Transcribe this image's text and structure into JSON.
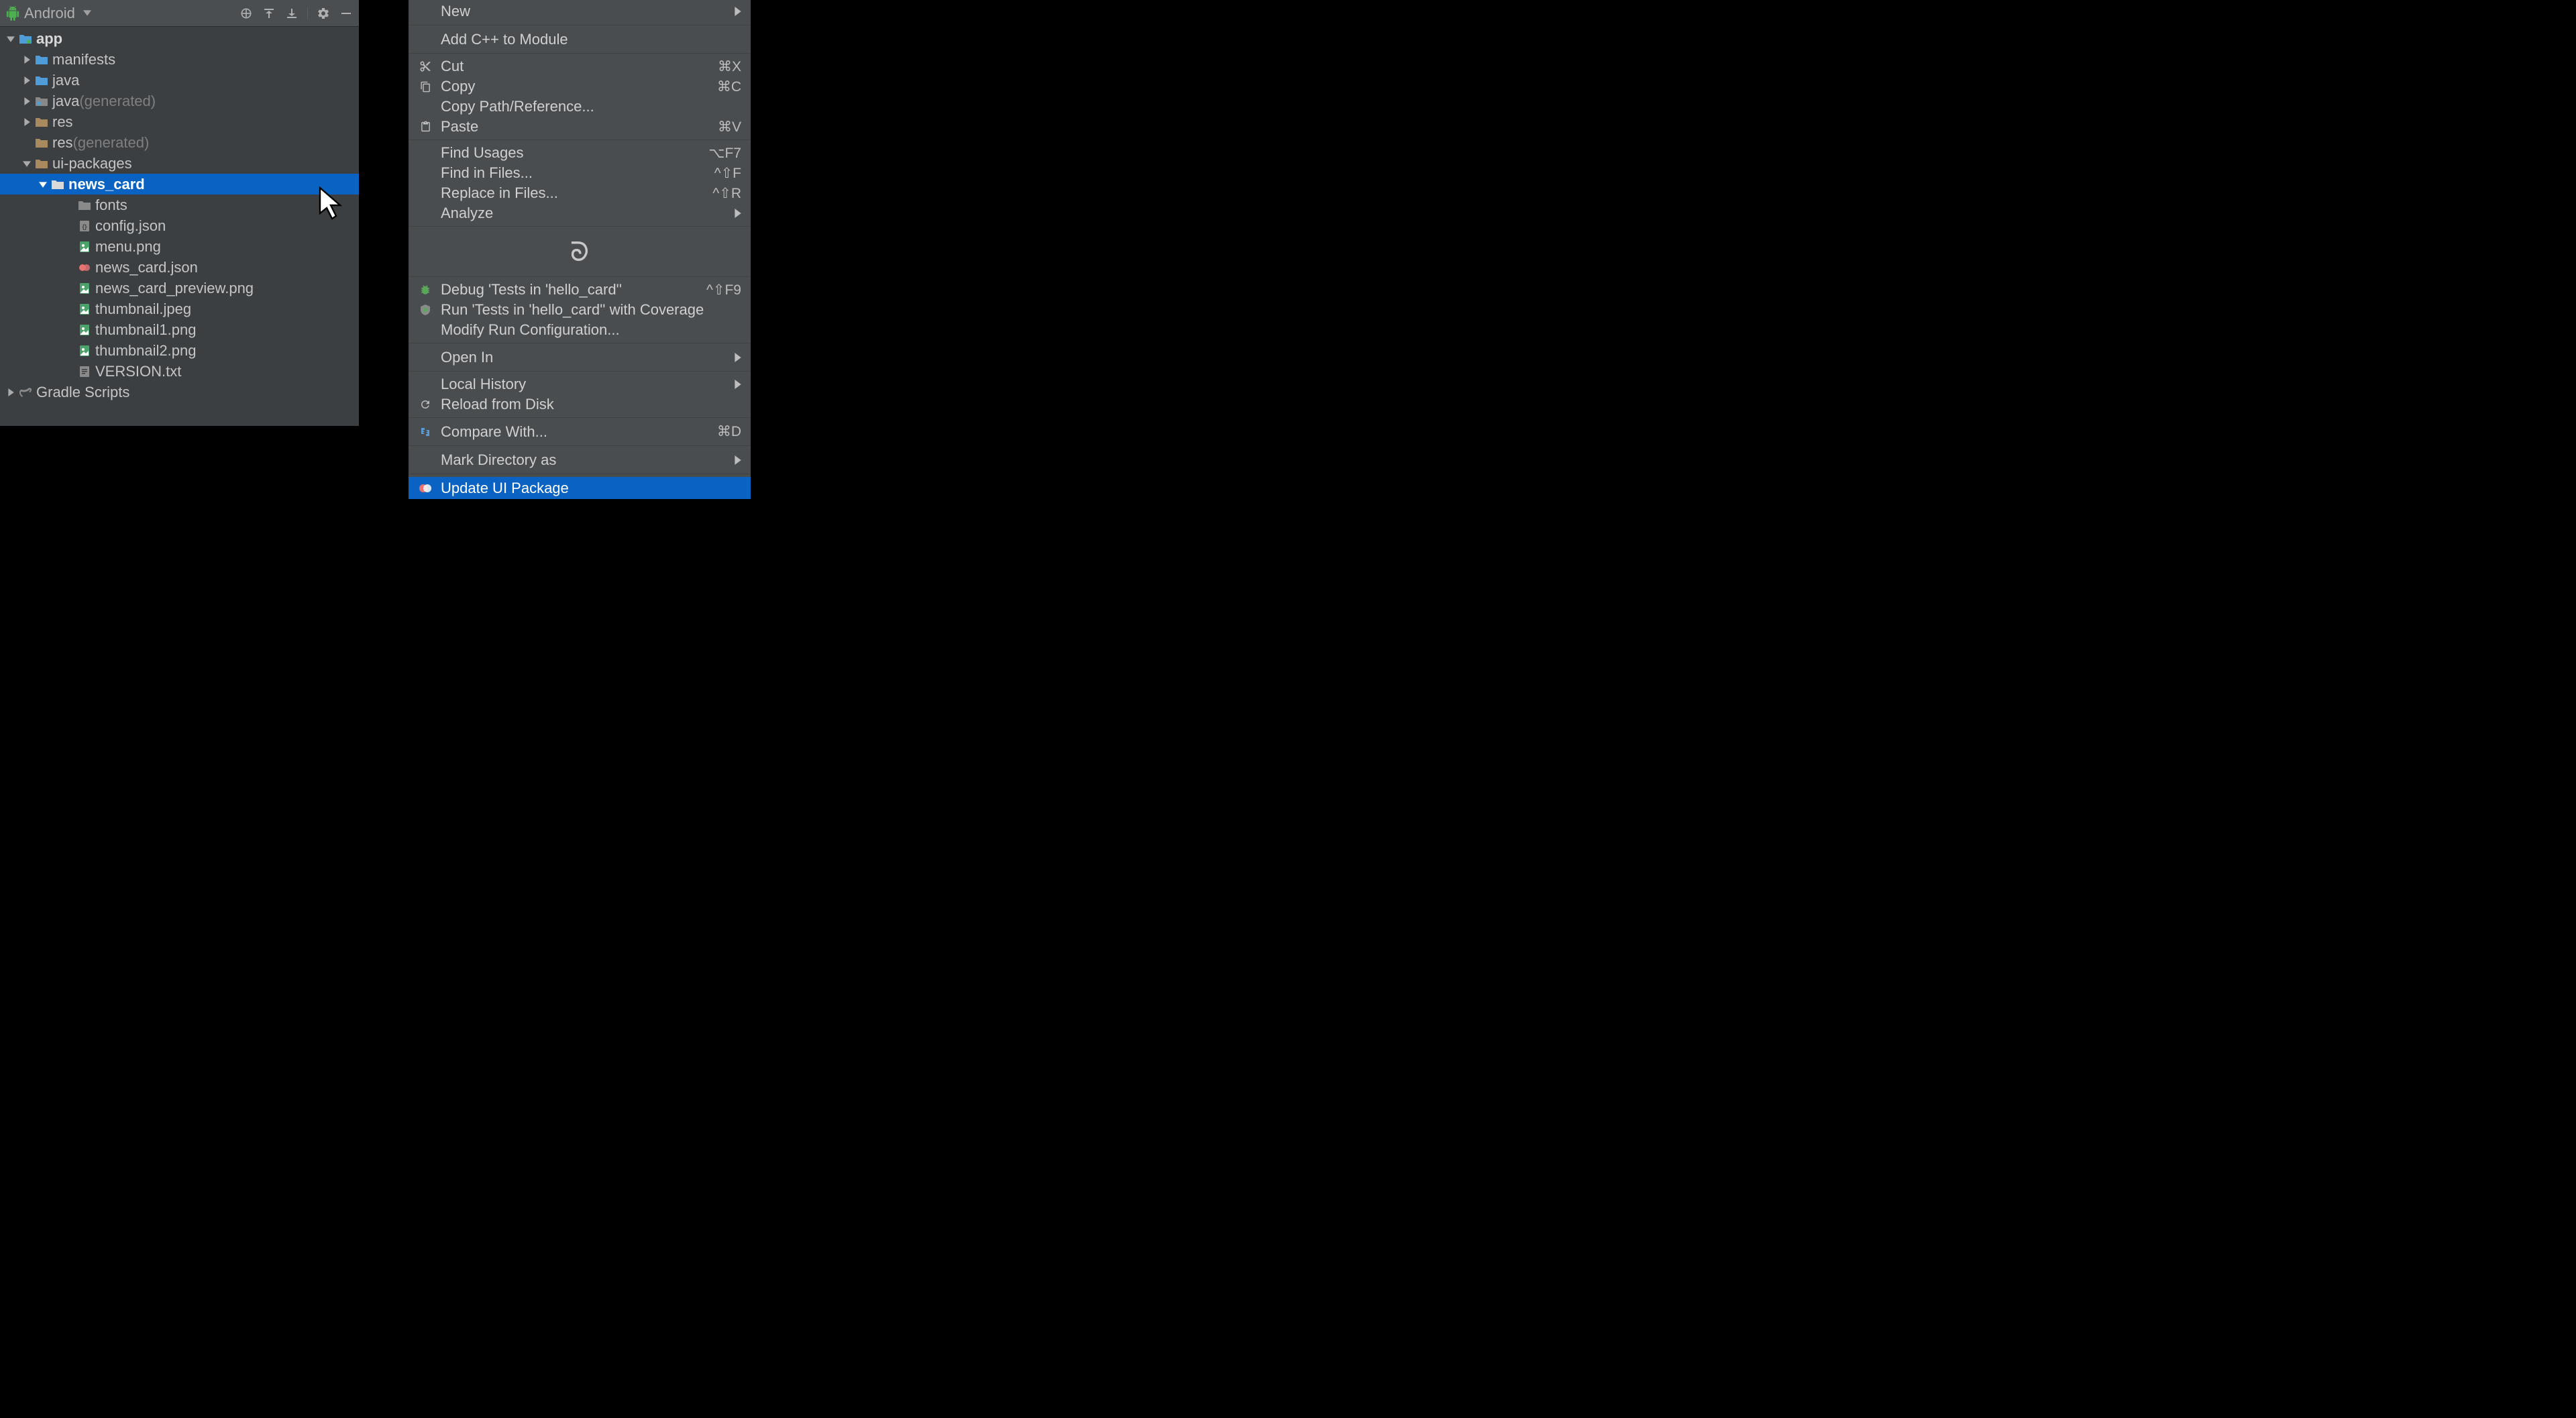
{
  "panel": {
    "view_label": "Android",
    "tree": {
      "app": "app",
      "manifests": "manifests",
      "java": "java",
      "java_gen": "java",
      "java_gen_suffix": " (generated)",
      "res": "res",
      "res_gen": "res",
      "res_gen_suffix": " (generated)",
      "ui_packages": "ui-packages",
      "news_card": "news_card",
      "fonts": "fonts",
      "config_json": "config.json",
      "menu_png": "menu.png",
      "news_card_json": "news_card.json",
      "news_card_preview_png": "news_card_preview.png",
      "thumbnail_jpeg": "thumbnail.jpeg",
      "thumbnail1_png": "thumbnail1.png",
      "thumbnail2_png": "thumbnail2.png",
      "version_txt": "VERSION.txt",
      "gradle_scripts": "Gradle Scripts"
    }
  },
  "menu": {
    "new": "New",
    "add_cpp": "Add C++ to Module",
    "cut": "Cut",
    "cut_sc": "⌘X",
    "copy": "Copy",
    "copy_sc": "⌘C",
    "copy_path": "Copy Path/Reference...",
    "paste": "Paste",
    "paste_sc": "⌘V",
    "find_usages": "Find Usages",
    "find_usages_sc": "⌥F7",
    "find_in_files": "Find in Files...",
    "find_in_files_sc": "^⇧F",
    "replace_in_files": "Replace in Files...",
    "replace_in_files_sc": "^⇧R",
    "analyze": "Analyze",
    "debug_tests": "Debug 'Tests in 'hello_card''",
    "debug_tests_sc": "^⇧F9",
    "run_tests_coverage": "Run 'Tests in 'hello_card'' with Coverage",
    "modify_run_config": "Modify Run Configuration...",
    "open_in": "Open In",
    "local_history": "Local History",
    "reload_from_disk": "Reload from Disk",
    "compare_with": "Compare With...",
    "compare_with_sc": "⌘D",
    "mark_directory_as": "Mark Directory as",
    "update_ui_package": "Update UI Package"
  }
}
